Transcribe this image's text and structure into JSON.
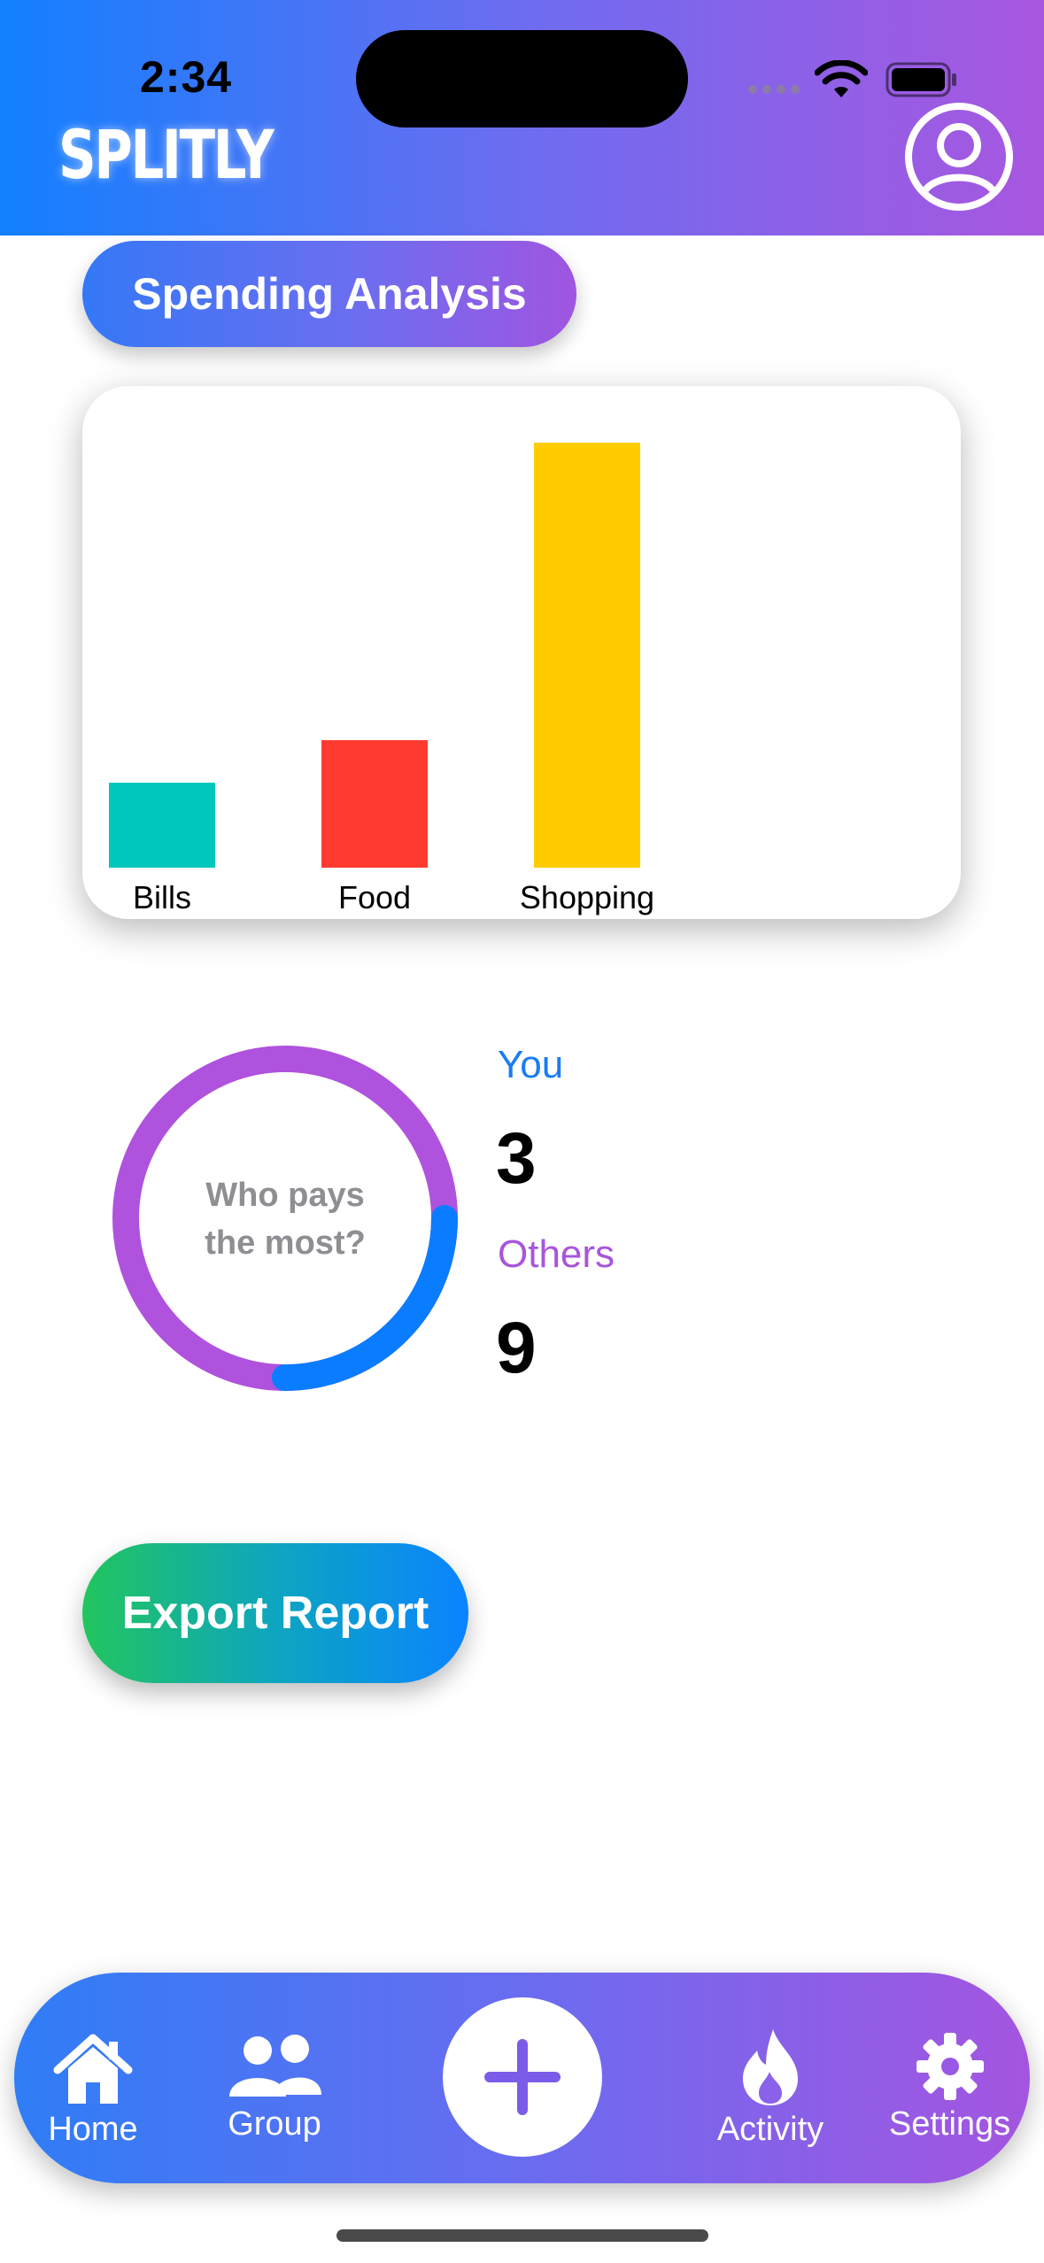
{
  "status_bar": {
    "time": "2:34"
  },
  "header": {
    "brand": "SPLITLY",
    "profile_icon": "person-circle-icon"
  },
  "section": {
    "title": "Spending Analysis"
  },
  "chart_data": {
    "type": "bar",
    "categories": [
      "Bills",
      "Food",
      "Shopping"
    ],
    "values": [
      20,
      30,
      100
    ],
    "colors": [
      "#00c7be",
      "#ff3b30",
      "#ffcc00"
    ],
    "title": "",
    "xlabel": "",
    "ylabel": "",
    "ylim": [
      0,
      100
    ],
    "grid": false
  },
  "pay_summary": {
    "center_line1": "Who pays",
    "center_line2": "the most?",
    "you_label": "You",
    "you_value": "3",
    "others_label": "Others",
    "others_value": "9",
    "you_value_num": 3,
    "others_value_num": 9,
    "you_color": "#0a7cff",
    "others_color": "#af52de"
  },
  "actions": {
    "export_label": "Export Report"
  },
  "tabs": [
    {
      "label": "Home",
      "icon": "house-icon"
    },
    {
      "label": "Group",
      "icon": "people-icon"
    },
    {
      "label": "",
      "icon": "plus-icon"
    },
    {
      "label": "Activity",
      "icon": "flame-icon"
    },
    {
      "label": "Settings",
      "icon": "gear-icon"
    }
  ]
}
